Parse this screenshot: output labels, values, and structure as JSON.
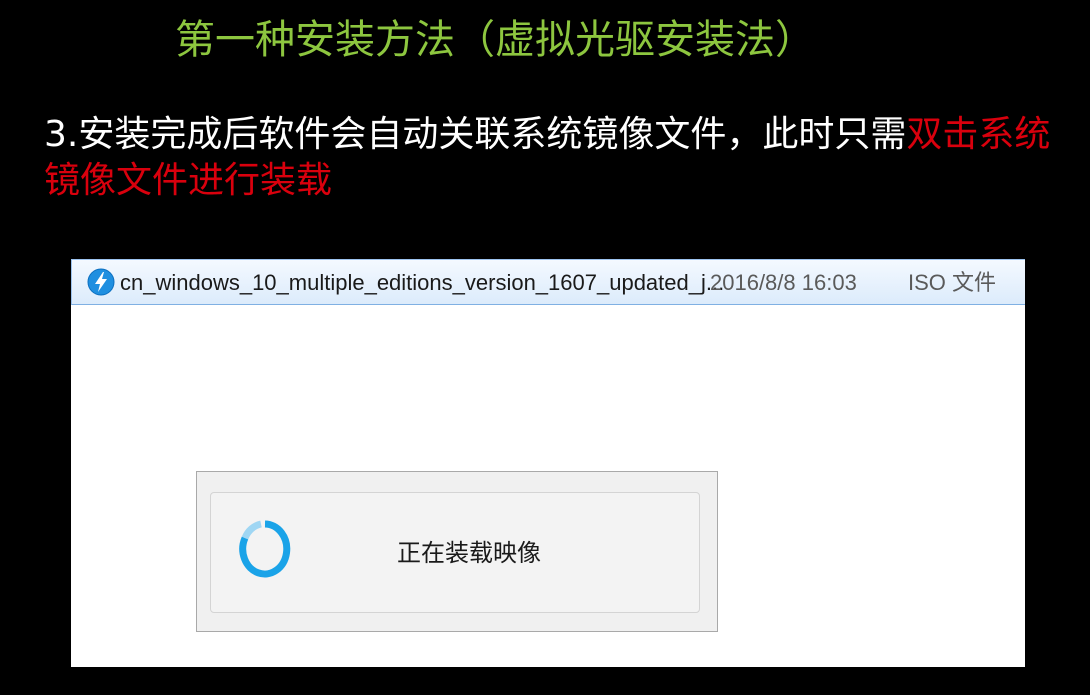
{
  "slide": {
    "title": "第一种安装方法（虚拟光驱安装法）",
    "instruction_part1": "3.安装完成后软件会自动关联系统镜像文件，此时只需",
    "instruction_part2": "双击系统镜像文件进行装载"
  },
  "colors": {
    "background": "#000000",
    "title": "#8dc63f",
    "instruction_text": "#ffffff",
    "highlight": "#d9000d",
    "spinner": "#1aa3e8"
  },
  "file_row": {
    "icon": "lightning-bolt-icon",
    "name": "cn_windows_10_multiple_editions_version_1607_updated_j...",
    "date": "2016/8/8 16:03",
    "type": "ISO 文件"
  },
  "mount_dialog": {
    "icon": "loading-spinner-icon",
    "status_text": "正在装载映像"
  }
}
